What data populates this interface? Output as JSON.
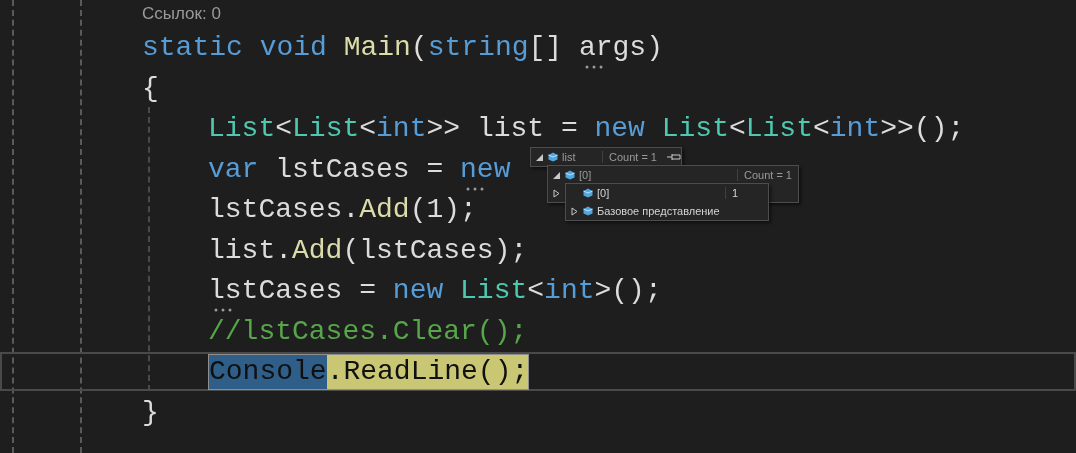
{
  "method": {
    "code_lens": "Ссылок: 0",
    "signature": [
      {
        "kind": "keyword",
        "text": "static"
      },
      {
        "kind": "keyword",
        "text": "void"
      },
      {
        "kind": "method",
        "text": "Main"
      },
      {
        "kind": "plain",
        "text": "("
      },
      {
        "kind": "keyword",
        "text": "string"
      },
      {
        "kind": "plain",
        "text": "[]"
      },
      {
        "kind": "plain",
        "text": "args",
        "dotted": true
      },
      {
        "kind": "plain",
        "text": ")"
      }
    ],
    "open_brace": "{",
    "body": [
      {
        "current": false,
        "tokens": [
          {
            "kind": "type",
            "text": "List"
          },
          {
            "kind": "plain",
            "text": "<"
          },
          {
            "kind": "type",
            "text": "List"
          },
          {
            "kind": "plain",
            "text": "<"
          },
          {
            "kind": "keyword",
            "text": "int"
          },
          {
            "kind": "plain",
            "text": ">> list ="
          },
          {
            "kind": "keyword",
            "text": "new"
          },
          {
            "kind": "type",
            "text": "List"
          },
          {
            "kind": "plain",
            "text": "<"
          },
          {
            "kind": "type",
            "text": "List"
          },
          {
            "kind": "plain",
            "text": "<"
          },
          {
            "kind": "keyword",
            "text": "int"
          },
          {
            "kind": "plain",
            "text": ">>();"
          }
        ]
      },
      {
        "current": false,
        "tokens": [
          {
            "kind": "keyword",
            "text": "var"
          },
          {
            "kind": "plain",
            "text": "lstCases ="
          },
          {
            "kind": "keyword",
            "text": "new",
            "dotted": true
          }
        ]
      },
      {
        "current": false,
        "tokens": [
          {
            "kind": "plain",
            "text": "lstCases."
          },
          {
            "kind": "method",
            "text": "Add"
          },
          {
            "kind": "plain",
            "text": "(1);"
          }
        ]
      },
      {
        "current": false,
        "tokens": [
          {
            "kind": "plain",
            "text": "list."
          },
          {
            "kind": "method",
            "text": "Add"
          },
          {
            "kind": "plain",
            "text": "(lstCases);"
          }
        ]
      },
      {
        "current": false,
        "tokens": [
          {
            "kind": "plain",
            "text": "lstCases",
            "dotted": true
          },
          {
            "kind": "plain",
            "text": "="
          },
          {
            "kind": "keyword",
            "text": "new"
          },
          {
            "kind": "type",
            "text": "List"
          },
          {
            "kind": "plain",
            "text": "<"
          },
          {
            "kind": "keyword",
            "text": "int"
          },
          {
            "kind": "plain",
            "text": ">();"
          }
        ]
      },
      {
        "current": false,
        "tokens": [
          {
            "kind": "comment",
            "text": "//lstCases.Clear();"
          }
        ]
      },
      {
        "current": true,
        "tokens": [
          {
            "kind": "selection",
            "text": "Console"
          },
          {
            "kind": "highlight",
            "text": ".ReadLine();"
          }
        ]
      }
    ],
    "close_brace": "}"
  },
  "datatip": {
    "name": "list",
    "value": "Count = 1",
    "expanded": true,
    "pinnable": true,
    "children": [
      {
        "name": "[0]",
        "value": "Count = 1",
        "expanded": true,
        "children": [
          {
            "kind": "leaf",
            "name": "[0]",
            "value": "1"
          },
          {
            "kind": "node",
            "name": "Базовое представление",
            "expanded": false
          }
        ]
      },
      {
        "expanded": false
      }
    ]
  }
}
